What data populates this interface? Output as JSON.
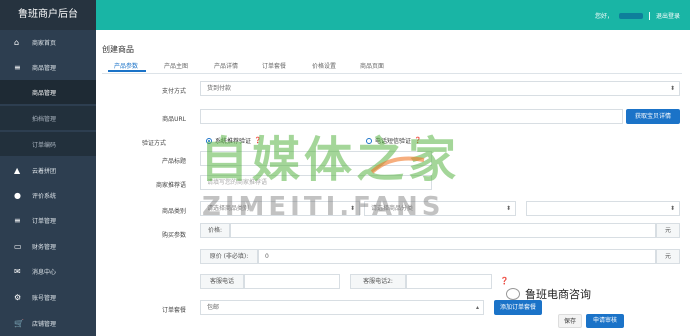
{
  "sidebar": {
    "title": "鲁班商户后台",
    "items": [
      {
        "label": "商家首页",
        "icon": "home-icon",
        "glyph": "⌂"
      },
      {
        "label": "商品管理",
        "icon": "list-icon",
        "glyph": "≡"
      },
      {
        "label": "云着拼团",
        "icon": "group-icon",
        "glyph": "▲"
      },
      {
        "label": "评价系统",
        "icon": "user-icon",
        "glyph": "●"
      },
      {
        "label": "订单管理",
        "icon": "orders-icon",
        "glyph": "≡"
      },
      {
        "label": "财务管理",
        "icon": "wallet-icon",
        "glyph": "▭"
      },
      {
        "label": "消息中心",
        "icon": "mail-icon",
        "glyph": "✉"
      },
      {
        "label": "账号管理",
        "icon": "settings-icon",
        "glyph": "⚙"
      },
      {
        "label": "店铺管理",
        "icon": "cart-icon",
        "glyph": "🛒"
      }
    ],
    "subitems": [
      "商品管理",
      "拍档管理",
      "订单编码"
    ]
  },
  "topbar": {
    "greeting": "您好，",
    "logout": "退出登录"
  },
  "page": {
    "title": "创建商品",
    "tabs": [
      "产品参数",
      "产品主图",
      "产品详情",
      "订单套餐",
      "价格设置",
      "商品页面"
    ]
  },
  "form": {
    "pay_label": "支付方式",
    "pay_value": "货到付款",
    "url_label": "商品URL",
    "fetch_btn": "获取宝贝详情",
    "verify_label": "验证方式",
    "verify_opt1": "系统推荐验证",
    "verify_opt2": "电话短信验证",
    "title_label": "产品标题",
    "promo_label": "商家推荐语",
    "promo_placeholder": "请填写您的商家推荐语",
    "category_label": "商品类别",
    "category_ph1": "请选择商品类别",
    "category_ph2": "请选择商品分类",
    "buy_label": "购买参数",
    "price_ph": "价格:",
    "price_unit": "元",
    "origin_ph": "原价 (非必填):",
    "origin_value": "0",
    "origin_unit": "元",
    "phone_ph": "客服电话",
    "phone2_ph": "客服电话2:",
    "package_label": "订单套餐",
    "package_value": "包邮",
    "add_pkg_btn": "添加订单套餐"
  },
  "footer": {
    "save": "保存",
    "submit": "申请审核"
  },
  "watermark": {
    "chars": "自媒体之家",
    "sub": "ZIMEITI.FANS",
    "wechat": "鲁班电商咨询"
  },
  "colors": {
    "sidebar": "#2d3e50",
    "topbar": "#19b5a5",
    "accent": "#1b73c8"
  }
}
